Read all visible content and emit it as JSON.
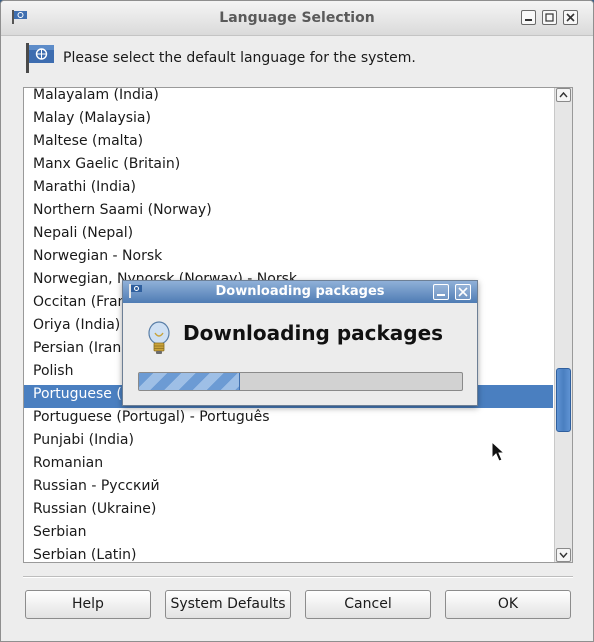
{
  "window": {
    "title": "Language Selection",
    "instruction": "Please select the default language for the system."
  },
  "languages": [
    "Malayalam (India)",
    "Malay (Malaysia)",
    "Maltese (malta)",
    "Manx Gaelic (Britain)",
    "Marathi (India)",
    "Northern Saami (Norway)",
    "Nepali (Nepal)",
    "Norwegian - Norsk",
    "Norwegian, Nynorsk (Norway) - Norsk",
    "Occitan (France)",
    "Oriya (India)",
    "Persian (Iran)",
    "Polish",
    "Portuguese (Brazil)",
    "Portuguese (Portugal) - Português",
    "Punjabi (India)",
    "Romanian",
    "Russian - Русский",
    "Russian (Ukraine)",
    "Serbian",
    "Serbian (Latin)"
  ],
  "selected_language": "Portuguese (Brazil)",
  "buttons": {
    "help": "Help",
    "system_defaults": "System Defaults",
    "cancel": "Cancel",
    "ok": "OK"
  },
  "progress_dialog": {
    "title": "Downloading packages",
    "heading": "Downloading packages",
    "progress_fraction": 0.31
  },
  "colors": {
    "selection": "#4a7fc0",
    "desktop": "#3a5f86"
  }
}
